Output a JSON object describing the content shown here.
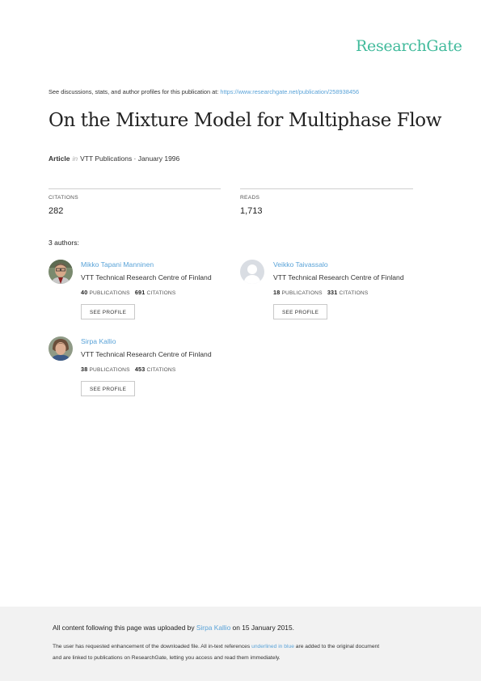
{
  "brand": "ResearchGate",
  "discuss": {
    "text": "See discussions, stats, and author profiles for this publication at: ",
    "url": "https://www.researchgate.net/publication/258938456"
  },
  "title": "On the Mixture Model for Multiphase Flow",
  "meta": {
    "type": "Article",
    "in": "in",
    "venue": "VTT Publications · January 1996"
  },
  "stats": {
    "citations_label": "CITATIONS",
    "citations_value": "282",
    "reads_label": "READS",
    "reads_value": "1,713"
  },
  "authors_heading": "3 authors:",
  "authors": [
    {
      "name": "Mikko Tapani Manninen",
      "affiliation": "VTT Technical Research Centre of Finland",
      "publications": "40",
      "publications_label": "PUBLICATIONS",
      "citations": "691",
      "citations_label": "CITATIONS",
      "button": "SEE PROFILE",
      "avatar": "photo"
    },
    {
      "name": "Veikko Taivassalo",
      "affiliation": "VTT Technical Research Centre of Finland",
      "publications": "18",
      "publications_label": "PUBLICATIONS",
      "citations": "331",
      "citations_label": "CITATIONS",
      "button": "SEE PROFILE",
      "avatar": "default-user-icon"
    },
    {
      "name": "Sirpa Kallio",
      "affiliation": "VTT Technical Research Centre of Finland",
      "publications": "38",
      "publications_label": "PUBLICATIONS",
      "citations": "453",
      "citations_label": "CITATIONS",
      "button": "SEE PROFILE",
      "avatar": "photo"
    }
  ],
  "footer": {
    "line1_pre": "All content following this page was uploaded by ",
    "line1_user": "Sirpa Kallio",
    "line1_post": " on 15 January 2015.",
    "line2_pre": "The user has requested enhancement of the downloaded file. All in-text references ",
    "line2_link": "underlined in blue",
    "line2_post": " are added to the original document",
    "line3": "and are linked to publications on ResearchGate, letting you access and read them immediately."
  },
  "colors": {
    "brand": "#40ba9b",
    "link": "#5aa3d8",
    "footer_bg": "#f2f2f2"
  }
}
